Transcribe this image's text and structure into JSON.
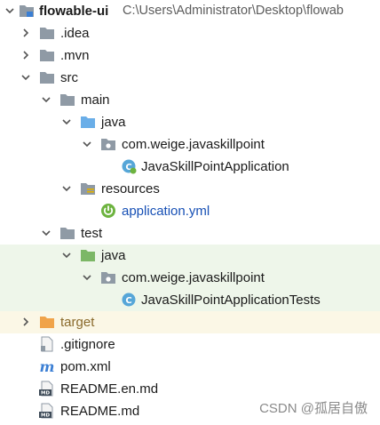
{
  "project": {
    "name": "flowable-ui",
    "path": "C:\\Users\\Administrator\\Desktop\\flowab"
  },
  "tree": {
    "idea": ".idea",
    "mvn": ".mvn",
    "src": "src",
    "main": "main",
    "main_java": "java",
    "main_pkg": "com.weige.javaskillpoint",
    "main_class": "JavaSkillPointApplication",
    "resources": "resources",
    "app_yml": "application.yml",
    "test": "test",
    "test_java": "java",
    "test_pkg": "com.weige.javaskillpoint",
    "test_class": "JavaSkillPointApplicationTests",
    "target": "target",
    "gitignore": ".gitignore",
    "pom": "pom.xml",
    "readme_en": "README.en.md",
    "readme": "README.md"
  },
  "watermark": "CSDN @孤居自傲",
  "colors": {
    "folder_gray": "#8f9aa5",
    "folder_blue": "#6aaee8",
    "folder_green": "#7cb766",
    "folder_orange": "#f0a34a",
    "spring_green": "#6db33f",
    "test_row_bg": "#eef6ea",
    "target_row_bg": "#fbf7e6"
  }
}
